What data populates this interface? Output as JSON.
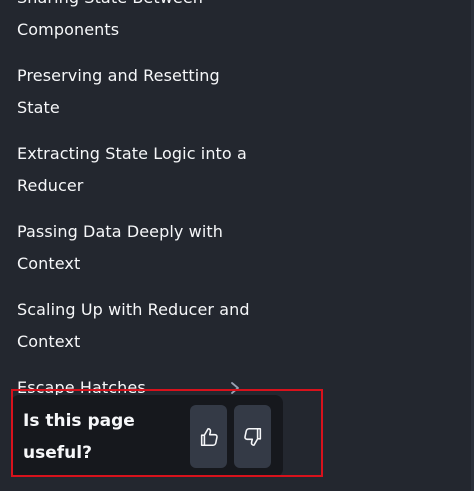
{
  "sidebar": {
    "items": [
      {
        "label_line1": "Sharing State Between",
        "label_line2": "Components"
      },
      {
        "label_line1": "Preserving and Resetting",
        "label_line2": "State"
      },
      {
        "label_line1": "Extracting State Logic into a",
        "label_line2": "Reducer"
      },
      {
        "label_line1": "Passing Data Deeply with",
        "label_line2": "Context"
      },
      {
        "label_line1": "Scaling Up with Reducer and",
        "label_line2": "Context"
      },
      {
        "label_line1": "Escape Hatches",
        "icon": "chevron-right-icon"
      }
    ]
  },
  "feedback": {
    "question_line1": "Is this page",
    "question_line2": "useful?",
    "yes_icon": "thumbs-up-icon",
    "no_icon": "thumbs-down-icon"
  },
  "colors": {
    "background": "#23272f",
    "panel": "#16181d",
    "button": "#343a46",
    "highlight": "#d8121c",
    "text": "#f6f7f9"
  }
}
